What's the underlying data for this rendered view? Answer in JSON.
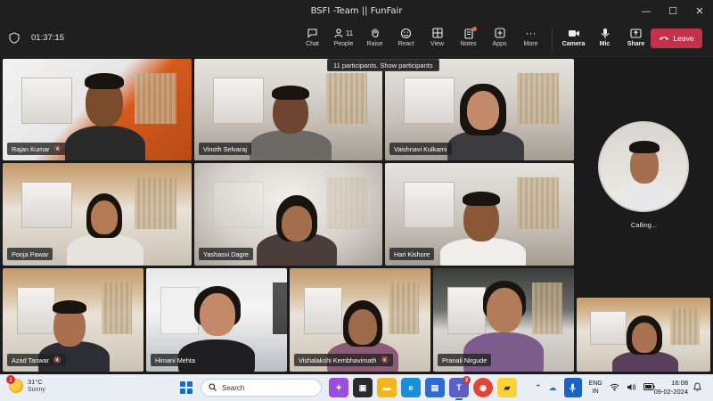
{
  "window": {
    "title": "BSFI -Team || FunFair",
    "controls": {
      "minimize": "—",
      "maximize": "☐",
      "close": "✕"
    }
  },
  "toolbar": {
    "timer": "01:37:15",
    "items": [
      {
        "label": "Chat",
        "icon": "chat-icon",
        "glyph": "💬"
      },
      {
        "label": "People",
        "icon": "people-icon",
        "glyph": "👥",
        "count": "11"
      },
      {
        "label": "Raise",
        "icon": "raise-hand-icon",
        "glyph": "✋"
      },
      {
        "label": "React",
        "icon": "react-icon",
        "glyph": "☺"
      },
      {
        "label": "View",
        "icon": "view-icon",
        "glyph": "▦"
      },
      {
        "label": "Notes",
        "icon": "notes-icon",
        "glyph": "📋"
      },
      {
        "label": "Apps",
        "icon": "apps-icon",
        "glyph": "⊕"
      },
      {
        "label": "More",
        "icon": "more-icon",
        "glyph": "···"
      }
    ],
    "media": [
      {
        "label": "Camera",
        "icon": "camera-icon",
        "glyph": "📹"
      },
      {
        "label": "Mic",
        "icon": "mic-icon",
        "glyph": "🎙"
      },
      {
        "label": "Share",
        "icon": "share-icon",
        "glyph": "⬆"
      }
    ],
    "leave_label": "Leave",
    "tooltip": "11 participants. Show participants"
  },
  "participants": [
    {
      "name": "Rajan Kumar",
      "muted": true
    },
    {
      "name": "Vinoth Selvaraj",
      "muted": false,
      "speaking": true
    },
    {
      "name": "Vaishnavi Kulkarni",
      "muted": false
    },
    {
      "name": "Pooja Pawar",
      "muted": false
    },
    {
      "name": "Yashasvi Dagre",
      "muted": false
    },
    {
      "name": "Hari Kishore",
      "muted": false
    },
    {
      "name": "Azad Tanwar",
      "muted": true
    },
    {
      "name": "Himani Mehta",
      "muted": false
    },
    {
      "name": "Vishalakshi Kembhavimath",
      "muted": true
    },
    {
      "name": "Pranali Nirgude",
      "muted": false
    },
    {
      "name": "",
      "muted": false
    }
  ],
  "calling": {
    "status": "Calling..."
  },
  "taskbar": {
    "weather": {
      "temp": "31°C",
      "desc": "Sunny",
      "badge": "1"
    },
    "search_placeholder": "Search",
    "apps": [
      {
        "name": "copilot",
        "color": "#9b4ddb",
        "glyph": "✦"
      },
      {
        "name": "task-view",
        "color": "#2b2b2b",
        "glyph": "▣"
      },
      {
        "name": "file-explorer",
        "color": "#f3b51e",
        "glyph": "▬"
      },
      {
        "name": "edge",
        "color": "#1a8fd8",
        "glyph": "e"
      },
      {
        "name": "store",
        "color": "#2e6bd1",
        "glyph": "▤"
      },
      {
        "name": "teams",
        "color": "#5b5fc7",
        "glyph": "T",
        "badge": "2",
        "active": true
      },
      {
        "name": "chrome",
        "color": "#e0453a",
        "glyph": "◉"
      },
      {
        "name": "sticky-notes",
        "color": "#f7d33b",
        "glyph": "▰"
      }
    ],
    "tray": {
      "language_top": "ENG",
      "language_bottom": "IN",
      "time": "16:08",
      "date": "09-02-2024"
    }
  }
}
